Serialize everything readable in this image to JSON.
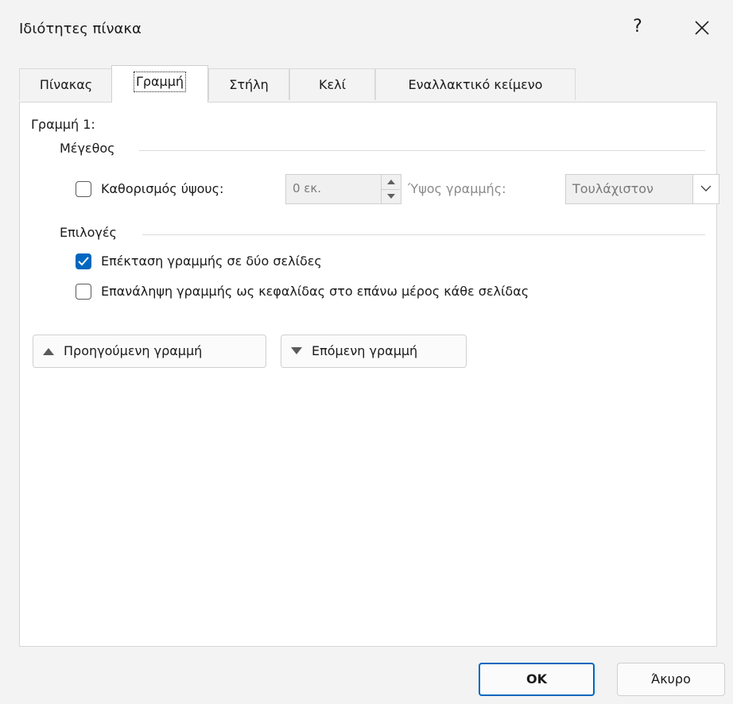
{
  "window": {
    "title": "Ιδιότητες πίνακα",
    "help_label": "?"
  },
  "tabs": [
    {
      "label": "Πίνακας",
      "active": false
    },
    {
      "label": "Γραμμή",
      "active": true
    },
    {
      "label": "Στήλη",
      "active": false
    },
    {
      "label": "Κελί",
      "active": false
    },
    {
      "label": "Εναλλακτικό κείμενο",
      "active": false
    }
  ],
  "row": {
    "heading": "Γραμμή 1:",
    "size_group": "Μέγεθος",
    "specify_height": {
      "label": "Καθορισμός ύψους:",
      "checked": false
    },
    "height_value": "0 εκ.",
    "row_height_label": "Ύψος γραμμής:",
    "row_height_option": "Τουλάχιστον",
    "options_group": "Επιλογές",
    "allow_break": {
      "label": "Επέκταση γραμμής σε δύο σελίδες",
      "checked": true
    },
    "repeat_header": {
      "label": "Επανάληψη γραμμής ως κεφαλίδας στο επάνω μέρος κάθε σελίδας",
      "checked": false
    },
    "prev_row": "Προηγούμενη γραμμή",
    "next_row": "Επόμενη γραμμή"
  },
  "footer": {
    "ok": "OK",
    "cancel": "Άκυρο"
  },
  "colors": {
    "accent": "#0067c0",
    "background": "#f3f3f3",
    "panel": "#ffffff"
  },
  "icons": {
    "close": "close-icon",
    "checkmark": "checkmark-icon",
    "spin_up": "chevron-up-icon",
    "spin_down": "chevron-down-icon",
    "dropdown": "chevron-down-icon",
    "prev": "triangle-up-icon",
    "next": "triangle-down-icon"
  }
}
